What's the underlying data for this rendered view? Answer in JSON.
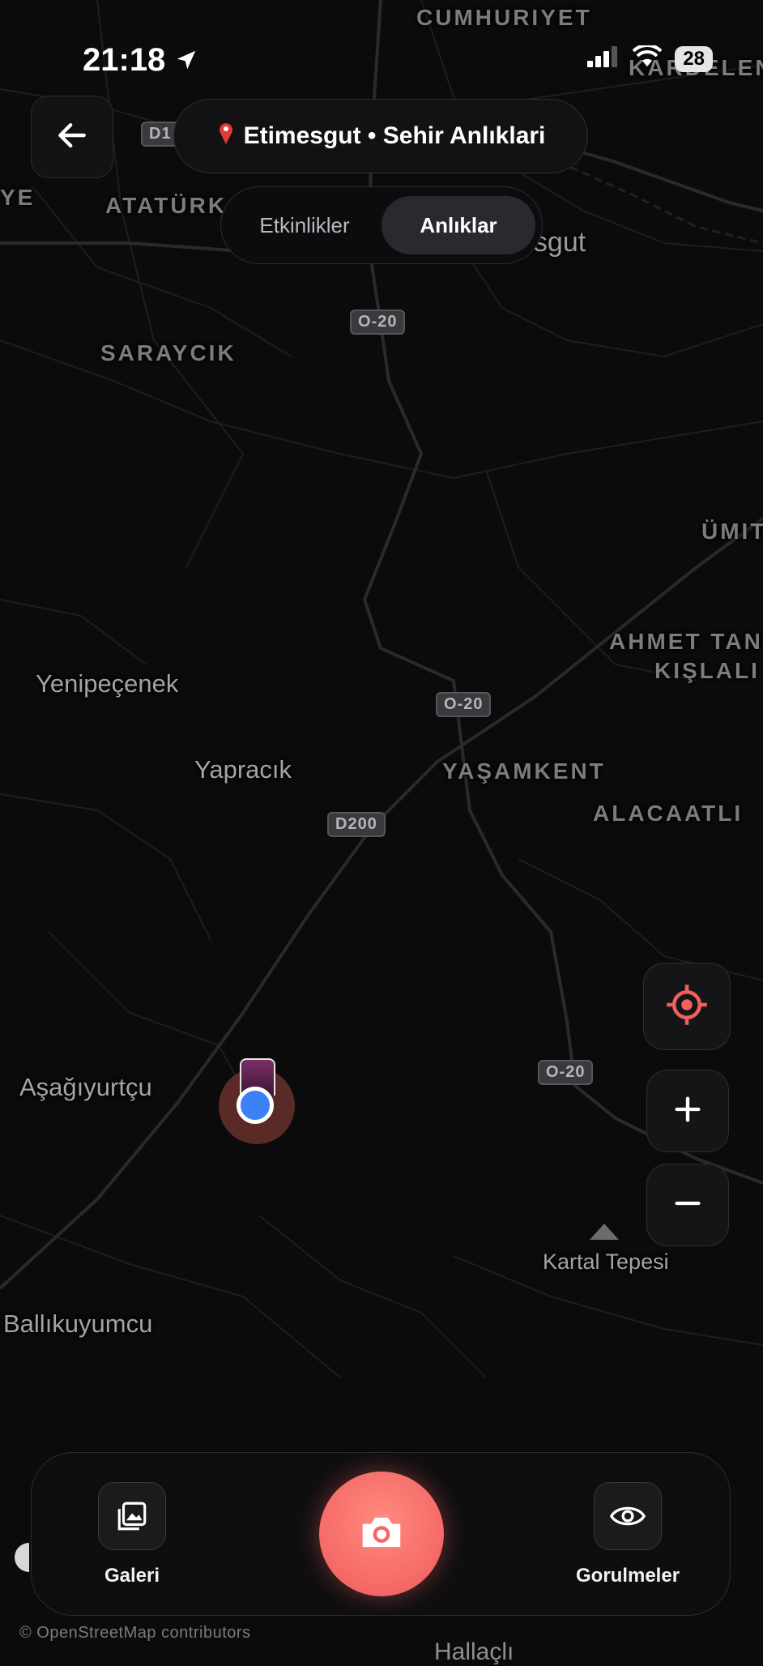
{
  "status_bar": {
    "time": "21:18",
    "battery": "28"
  },
  "header": {
    "title": "Etimesgut • Sehir Anlıklari",
    "pin_icon": "map-pin-icon",
    "tabs": [
      {
        "label": "Etkinlikler",
        "active": false
      },
      {
        "label": "Anlıklar",
        "active": true
      }
    ]
  },
  "map": {
    "labels": {
      "cumhuriyet": "CUMHURIYET",
      "kardelen": "KARDELEN",
      "ye": "YE",
      "ataturk": "ATATÜRK",
      "etimesgut": "Etimesgut",
      "saraycik": "SARAYCIK",
      "umit": "ÜMIT",
      "ahmet_tan": "AHMET TAN",
      "kislali": "KIŞLALI",
      "yenipecenek": "Yenipeçenek",
      "yapracik": "Yapracık",
      "yasamkent": "YAŞAMKENT",
      "alacaatli": "ALACAATLI",
      "asagiyurtcu": "Aşağıyurtçu",
      "kartal_tepesi": "Kartal Tepesi",
      "balikuyumcu": "Ballıkuyumcu",
      "hallacli": "Hallaçlı"
    },
    "shields": {
      "d1": "D1",
      "o20_a": "O-20",
      "o20_b": "O-20",
      "d200": "D200",
      "o20_c": "O-20"
    }
  },
  "controls": {
    "locate_icon": "crosshair-icon",
    "zoom_in_icon": "plus-icon",
    "zoom_out_icon": "minus-icon"
  },
  "bottom_bar": {
    "gallery_label": "Galeri",
    "views_label": "Gorulmeler",
    "camera_icon": "camera-icon"
  },
  "attribution": "© OpenStreetMap contributors",
  "colors": {
    "accent": "#f05a5a",
    "user_dot": "#3b82f6",
    "background": "#0b0b0c"
  }
}
